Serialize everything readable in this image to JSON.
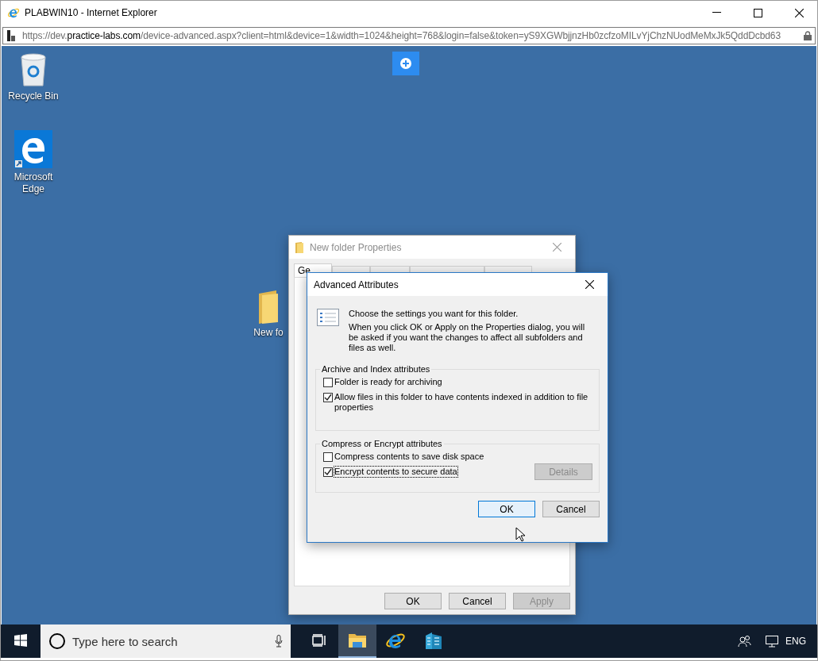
{
  "browser": {
    "title": "PLABWIN10 - Internet Explorer",
    "address_parts": [
      {
        "text": "https://dev.",
        "highlighted": false
      },
      {
        "text": "practice-labs.com",
        "highlighted": true
      },
      {
        "text": "/device-advanced.aspx?client=html&device=1&width=1024&height=768&login=false&token=yS9XGWbjjnzHb0zcfzoMILvYjChzNUodMeMxJk5QddDcbd63",
        "highlighted": false
      }
    ]
  },
  "desktop_icons": [
    {
      "kind": "recycle-bin",
      "label": "Recycle Bin"
    },
    {
      "kind": "edge",
      "label": "Microsoft Edge"
    },
    {
      "kind": "folder",
      "label": "New fo"
    }
  ],
  "properties_dialog": {
    "title": "New folder Properties",
    "active": false,
    "tabs": [
      {
        "label": "Ge",
        "selected": true
      },
      {
        "selected": false
      },
      {
        "selected": false
      },
      {
        "selected": false
      },
      {
        "selected": false
      }
    ],
    "buttons": [
      {
        "label": "OK",
        "disabled": false
      },
      {
        "label": "Cancel",
        "disabled": false
      },
      {
        "label": "Apply",
        "disabled": true
      }
    ]
  },
  "advanced_dialog": {
    "title": "Advanced Attributes",
    "active": true,
    "intro": "Choose the settings you want for this folder.",
    "description": "When you click OK or Apply on the Properties dialog, you will be asked if you want the changes to affect all subfolders and files as well.",
    "groups": [
      {
        "legend": "Archive and Index attributes",
        "options": [
          {
            "label": "Folder is ready for archiving",
            "checked": false,
            "focused": false
          },
          {
            "label": "Allow files in this folder to have contents indexed in addition to file properties",
            "checked": true,
            "focused": false
          }
        ]
      },
      {
        "legend": "Compress or Encrypt attributes",
        "options": [
          {
            "label": "Compress contents to save disk space",
            "checked": false,
            "focused": false
          },
          {
            "label": "Encrypt contents to secure data",
            "checked": true,
            "focused": true
          }
        ],
        "side_button": {
          "label": "Details",
          "disabled": true
        }
      }
    ],
    "buttons": [
      {
        "label": "OK",
        "default": true
      },
      {
        "label": "Cancel",
        "default": false
      }
    ]
  },
  "taskbar": {
    "search_placeholder": "Type here to search",
    "apps": [
      {
        "kind": "task-view",
        "selected": false
      },
      {
        "kind": "file-explorer",
        "selected": true
      },
      {
        "kind": "internet-explorer",
        "selected": false
      },
      {
        "kind": "buildings",
        "selected": false
      }
    ],
    "language": "ENG"
  }
}
